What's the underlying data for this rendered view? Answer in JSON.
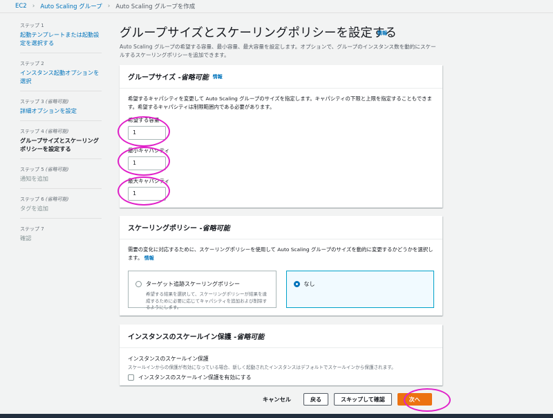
{
  "breadcrumb": {
    "items": [
      "EC2",
      "Auto Scaling グループ"
    ],
    "current": "Auto Scaling グループを作成"
  },
  "steps": [
    {
      "num": "ステップ 1",
      "opt": "",
      "title": "起動テンプレートまたは起動設定を選択する",
      "state": "link"
    },
    {
      "num": "ステップ 2",
      "opt": "",
      "title": "インスタンス起動オプションを選択",
      "state": "link"
    },
    {
      "num": "ステップ 3",
      "opt": "(省略可能)",
      "title": "詳細オプションを設定",
      "state": "link"
    },
    {
      "num": "ステップ 4",
      "opt": "(省略可能)",
      "title": "グループサイズとスケーリングポリシーを設定する",
      "state": "active"
    },
    {
      "num": "ステップ 5",
      "opt": "(省略可能)",
      "title": "通知を追加",
      "state": "disabled"
    },
    {
      "num": "ステップ 6",
      "opt": "(省略可能)",
      "title": "タグを追加",
      "state": "disabled"
    },
    {
      "num": "ステップ 7",
      "opt": "",
      "title": "確認",
      "state": "disabled"
    }
  ],
  "page": {
    "title": "グループサイズとスケーリングポリシーを設定する",
    "info": "情報",
    "intro": "Auto Scaling グループの希望する容量、最小容量、最大容量を設定します。オプションで、グループのインスタンス数を動的にスケールするスケーリングポリシーを追加できます。"
  },
  "group_size": {
    "header": "グループサイズ - ",
    "header_opt": "省略可能",
    "info": "情報",
    "desc": "希望するキャパシティを変更して Auto Scaling グループのサイズを指定します。キャパシティの下限と上限を指定することもできます。希望するキャパシティは制限範囲内である必要があります。",
    "desired_label": "希望する容量",
    "desired_value": "1",
    "min_label": "最小キャパシティ",
    "min_value": "1",
    "max_label": "最大キャパシティ",
    "max_value": "1"
  },
  "scaling": {
    "header": "スケーリングポリシー - ",
    "header_opt": "省略可能",
    "desc": "需要の変化に対応するために、スケーリングポリシーを使用して Auto Scaling グループのサイズを動的に変更するかどうかを選択します。",
    "info": "情報",
    "option_target": "ターゲット追跡スケーリングポリシー",
    "option_target_desc": "希望する結果を選択して、スケーリングポリシーが結果を達成するために必要に応じてキャパシティを追加および削除するようにします。",
    "option_none": "なし"
  },
  "scale_in": {
    "header": "インスタンスのスケールイン保護 - ",
    "header_opt": "省略可能",
    "label": "インスタンスのスケールイン保護",
    "desc": "スケールインからの保護が有効になっている場合、新しく起動されたインスタンスはデフォルトでスケールインから保護されます。",
    "checkbox": "インスタンスのスケールイン保護を有効にする"
  },
  "footer": {
    "cancel": "キャンセル",
    "back": "戻る",
    "skip": "スキップして確認",
    "next": "次へ"
  }
}
